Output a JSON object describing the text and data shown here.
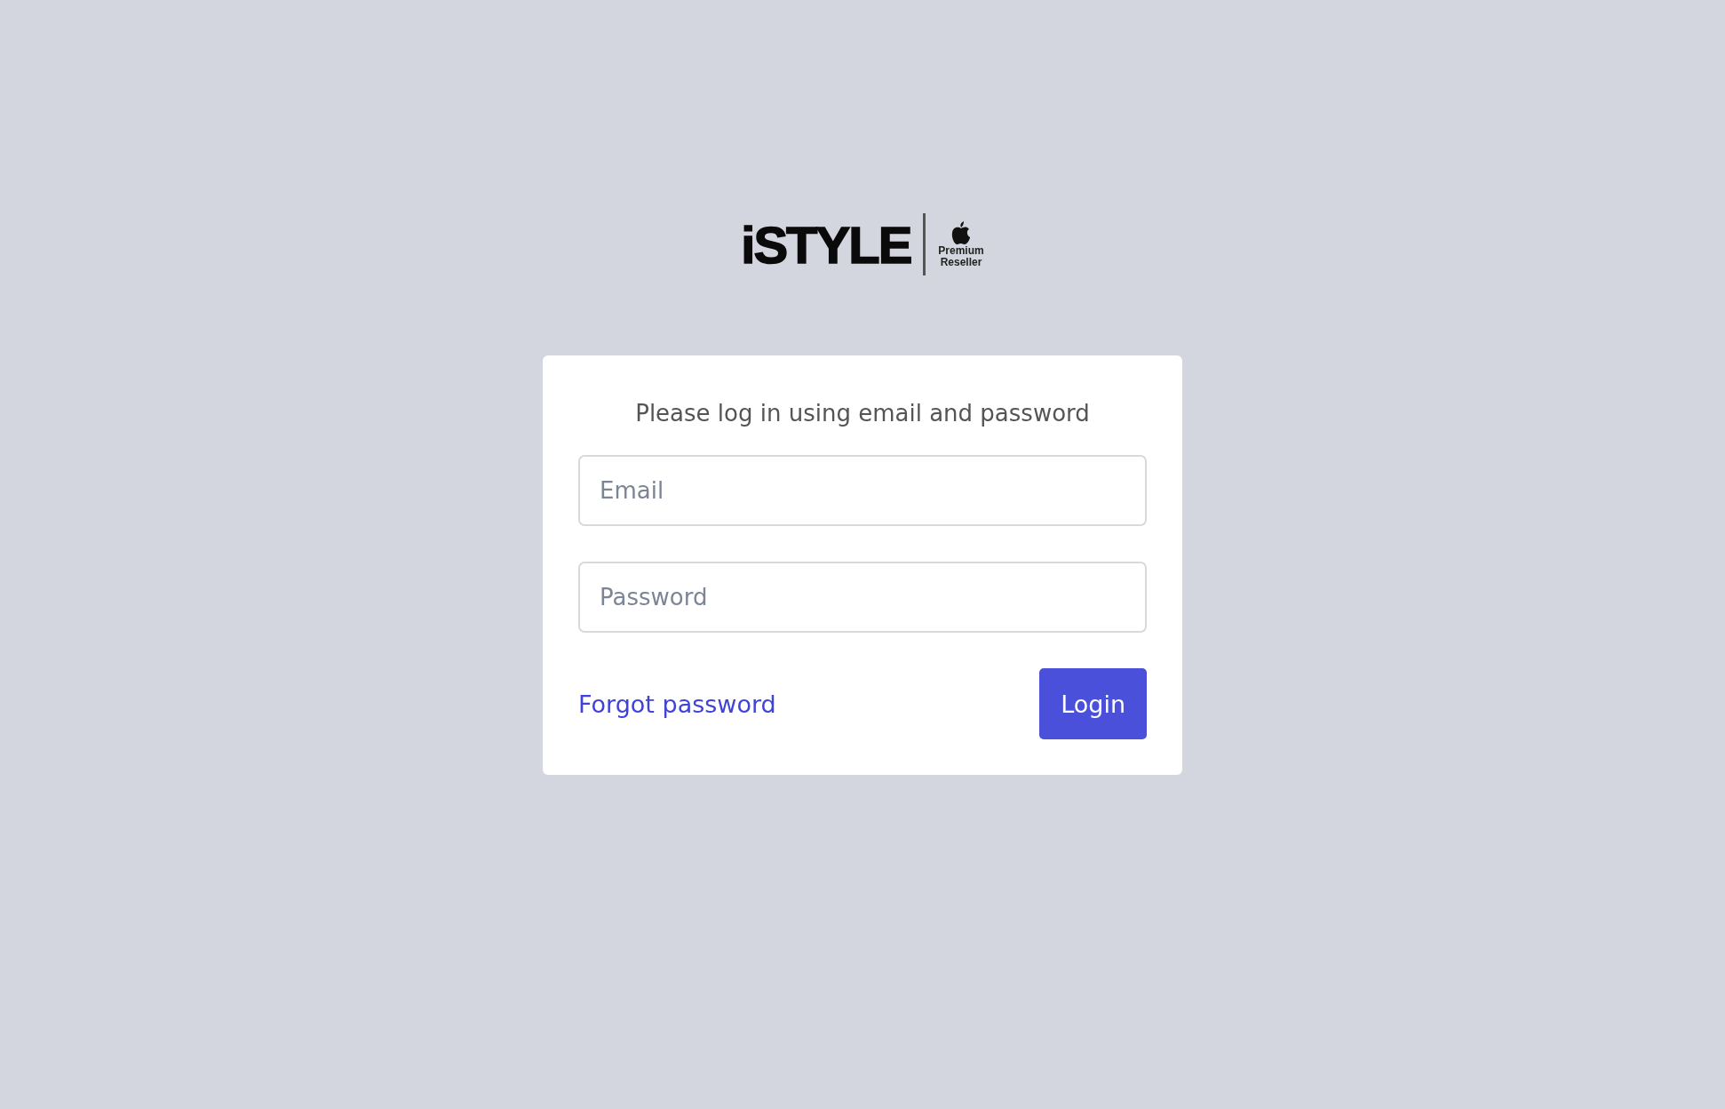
{
  "logo": {
    "brand": "iSTYLE",
    "badge": [
      "Premium",
      "Reseller"
    ]
  },
  "login_card": {
    "prompt": "Please log in using email and password",
    "fields": [
      {
        "placeholder": "Email"
      },
      {
        "placeholder": "Password"
      }
    ],
    "forgot_link": "Forgot password",
    "login_button": "Login"
  }
}
